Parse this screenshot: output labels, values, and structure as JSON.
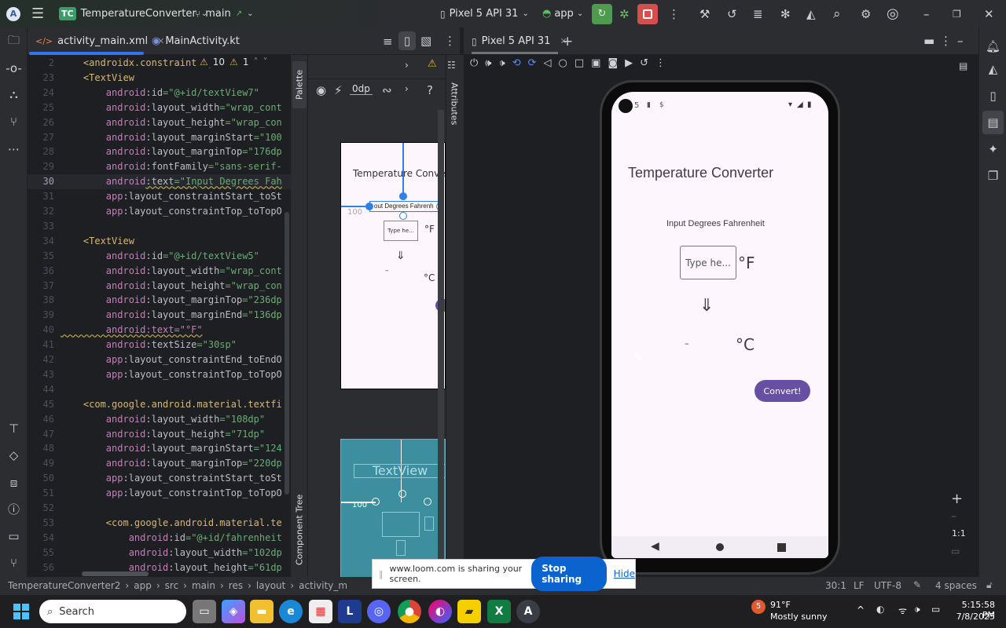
{
  "titlebar": {
    "project_badge": "TC",
    "project_name": "TemperatureConverter",
    "branch": "main",
    "device": "Pixel 5 API 31",
    "run_config": "app"
  },
  "editor": {
    "tabs": [
      {
        "label": "activity_main.xml",
        "active": true
      },
      {
        "label": "MainActivity.kt",
        "active": false
      }
    ],
    "breadcrumb_line": "<androidx.constraintlayou",
    "warnings": "10",
    "weak_warnings": "1",
    "current_line": 30,
    "lines": [
      {
        "n": "2",
        "parts": [
          [
            "k-tag",
            "    <androidx.constraintlayou"
          ]
        ]
      },
      {
        "n": "23",
        "parts": [
          [
            "k-tag",
            "    <TextView"
          ]
        ]
      },
      {
        "n": "24",
        "parts": [
          [
            "k-ns",
            "        android"
          ],
          [
            "k-pun",
            ":"
          ],
          [
            "k-attr",
            "id"
          ],
          [
            "k-str",
            "=\"@+id/textView7\""
          ]
        ]
      },
      {
        "n": "25",
        "parts": [
          [
            "k-ns",
            "        android"
          ],
          [
            "k-pun",
            ":"
          ],
          [
            "k-attr",
            "layout_width"
          ],
          [
            "k-str",
            "=\"wrap_cont"
          ]
        ]
      },
      {
        "n": "26",
        "parts": [
          [
            "k-ns",
            "        android"
          ],
          [
            "k-pun",
            ":"
          ],
          [
            "k-attr",
            "layout_height"
          ],
          [
            "k-str",
            "=\"wrap_con"
          ]
        ]
      },
      {
        "n": "27",
        "parts": [
          [
            "k-ns",
            "        android"
          ],
          [
            "k-pun",
            ":"
          ],
          [
            "k-attr",
            "layout_marginStart"
          ],
          [
            "k-str",
            "=\"100"
          ]
        ]
      },
      {
        "n": "28",
        "parts": [
          [
            "k-ns",
            "        android"
          ],
          [
            "k-pun",
            ":"
          ],
          [
            "k-attr",
            "layout_marginTop"
          ],
          [
            "k-str",
            "=\"176dp"
          ]
        ]
      },
      {
        "n": "29",
        "parts": [
          [
            "k-ns",
            "        android"
          ],
          [
            "k-pun",
            ":"
          ],
          [
            "k-attr",
            "fontFamily"
          ],
          [
            "k-str",
            "=\"sans-serif-"
          ]
        ]
      },
      {
        "n": "30",
        "parts": [
          [
            "k-ns",
            "        android"
          ],
          [
            "k-pun",
            ":"
          ],
          [
            "k-attr",
            "text"
          ],
          [
            "k-str",
            "=\"Input Degrees Fah"
          ]
        ]
      },
      {
        "n": "31",
        "parts": [
          [
            "k-ns",
            "        app"
          ],
          [
            "k-pun",
            ":"
          ],
          [
            "k-attr",
            "layout_constraintStart_toSt"
          ]
        ]
      },
      {
        "n": "32",
        "parts": [
          [
            "k-ns",
            "        app"
          ],
          [
            "k-pun",
            ":"
          ],
          [
            "k-attr",
            "layout_constraintTop_toTopO"
          ]
        ]
      },
      {
        "n": "33",
        "parts": []
      },
      {
        "n": "34",
        "parts": [
          [
            "k-tag",
            "    <TextView"
          ]
        ]
      },
      {
        "n": "35",
        "parts": [
          [
            "k-ns",
            "        android"
          ],
          [
            "k-pun",
            ":"
          ],
          [
            "k-attr",
            "id"
          ],
          [
            "k-str",
            "=\"@+id/textView5\""
          ]
        ]
      },
      {
        "n": "36",
        "parts": [
          [
            "k-ns",
            "        android"
          ],
          [
            "k-pun",
            ":"
          ],
          [
            "k-attr",
            "layout_width"
          ],
          [
            "k-str",
            "=\"wrap_cont"
          ]
        ]
      },
      {
        "n": "37",
        "parts": [
          [
            "k-ns",
            "        android"
          ],
          [
            "k-pun",
            ":"
          ],
          [
            "k-attr",
            "layout_height"
          ],
          [
            "k-str",
            "=\"wrap_con"
          ]
        ]
      },
      {
        "n": "38",
        "parts": [
          [
            "k-ns",
            "        android"
          ],
          [
            "k-pun",
            ":"
          ],
          [
            "k-attr",
            "layout_marginTop"
          ],
          [
            "k-str",
            "=\"236dp"
          ]
        ]
      },
      {
        "n": "39",
        "parts": [
          [
            "k-ns",
            "        android"
          ],
          [
            "k-pun",
            ":"
          ],
          [
            "k-attr",
            "layout_marginEnd"
          ],
          [
            "k-str",
            "=\"136dp"
          ]
        ]
      },
      {
        "n": "40",
        "parts": [
          [
            "k-ns warnul",
            "        android:text=\"°F\""
          ]
        ]
      },
      {
        "n": "41",
        "parts": [
          [
            "k-ns",
            "        android"
          ],
          [
            "k-pun",
            ":"
          ],
          [
            "k-attr",
            "textSize"
          ],
          [
            "k-str",
            "=\"30sp\""
          ]
        ]
      },
      {
        "n": "42",
        "parts": [
          [
            "k-ns",
            "        app"
          ],
          [
            "k-pun",
            ":"
          ],
          [
            "k-attr",
            "layout_constraintEnd_toEndO"
          ]
        ]
      },
      {
        "n": "43",
        "parts": [
          [
            "k-ns",
            "        app"
          ],
          [
            "k-pun",
            ":"
          ],
          [
            "k-attr",
            "layout_constraintTop_toTopO"
          ]
        ]
      },
      {
        "n": "44",
        "parts": []
      },
      {
        "n": "45",
        "parts": [
          [
            "k-tag",
            "    <com.google.android.material.textfi"
          ]
        ]
      },
      {
        "n": "46",
        "parts": [
          [
            "k-ns",
            "        android"
          ],
          [
            "k-pun",
            ":"
          ],
          [
            "k-attr",
            "layout_width"
          ],
          [
            "k-str",
            "=\"108dp\""
          ]
        ]
      },
      {
        "n": "47",
        "parts": [
          [
            "k-ns",
            "        android"
          ],
          [
            "k-pun",
            ":"
          ],
          [
            "k-attr",
            "layout_height"
          ],
          [
            "k-str",
            "=\"71dp\""
          ]
        ]
      },
      {
        "n": "48",
        "parts": [
          [
            "k-ns",
            "        android"
          ],
          [
            "k-pun",
            ":"
          ],
          [
            "k-attr",
            "layout_marginStart"
          ],
          [
            "k-str",
            "=\"124"
          ]
        ]
      },
      {
        "n": "49",
        "parts": [
          [
            "k-ns",
            "        android"
          ],
          [
            "k-pun",
            ":"
          ],
          [
            "k-attr",
            "layout_marginTop"
          ],
          [
            "k-str",
            "=\"220dp"
          ]
        ]
      },
      {
        "n": "50",
        "parts": [
          [
            "k-ns",
            "        app"
          ],
          [
            "k-pun",
            ":"
          ],
          [
            "k-attr",
            "layout_constraintStart_toSt"
          ]
        ]
      },
      {
        "n": "51",
        "parts": [
          [
            "k-ns",
            "        app"
          ],
          [
            "k-pun",
            ":"
          ],
          [
            "k-attr",
            "layout_constraintTop_toTopO"
          ]
        ]
      },
      {
        "n": "52",
        "parts": []
      },
      {
        "n": "53",
        "parts": [
          [
            "k-tag",
            "        <com.google.android.material.te"
          ]
        ]
      },
      {
        "n": "54",
        "parts": [
          [
            "k-ns",
            "            android"
          ],
          [
            "k-pun",
            ":"
          ],
          [
            "k-attr",
            "id"
          ],
          [
            "k-str",
            "=\"@+id/fahrenheit"
          ]
        ]
      },
      {
        "n": "55",
        "parts": [
          [
            "k-ns",
            "            android"
          ],
          [
            "k-pun",
            ":"
          ],
          [
            "k-attr",
            "layout_width"
          ],
          [
            "k-str",
            "=\"102dp"
          ]
        ]
      },
      {
        "n": "56",
        "parts": [
          [
            "k-ns",
            "            android"
          ],
          [
            "k-pun",
            ":"
          ],
          [
            "k-attr",
            "layout_height"
          ],
          [
            "k-str",
            "=\"61dp"
          ]
        ]
      }
    ]
  },
  "design": {
    "palette_label": "Palette",
    "attributes_label": "Attributes",
    "component_tree_label": "Component Tree",
    "margin_value": "0dp",
    "preview_title": "Temperature Converter",
    "preview_label": "out Degrees Fahrenh",
    "preview_margin": "100",
    "preview_input": "Type he...",
    "preview_f": "°F",
    "preview_arrow": "⇓",
    "preview_dash": "–",
    "preview_c": "°C",
    "blueprint_text": "TextView",
    "blueprint_margin": "100"
  },
  "running_devices": {
    "tab_label": "Pixel 5 API 31",
    "zoom_ratio": "1:1"
  },
  "app_screen": {
    "status_time": "5",
    "title": "Temperature Converter",
    "input_label": "Input Degrees Fahrenheit",
    "input_placeholder": "Type he...",
    "fahrenheit_unit": "°F",
    "arrow": "⇓",
    "result": "–",
    "celsius_unit": "°C",
    "convert_button": "Convert!",
    "accent": "#6750a4"
  },
  "statusbar": {
    "breadcrumbs": [
      "TemperatureConverter2",
      "app",
      "src",
      "main",
      "res",
      "layout",
      "activity_m"
    ],
    "position": "30:1",
    "line_sep": "LF",
    "encoding": "UTF-8",
    "indent": "4 spaces"
  },
  "loom": {
    "message": "www.loom.com is sharing your screen.",
    "stop_label": "Stop sharing",
    "hide_label": "Hide"
  },
  "taskbar": {
    "search_label": "Search",
    "weather_temp": "91°F",
    "weather_desc": "Mostly sunny",
    "weather_badge": "5",
    "time": "5:15:58 PM",
    "date": "7/8/2025"
  }
}
